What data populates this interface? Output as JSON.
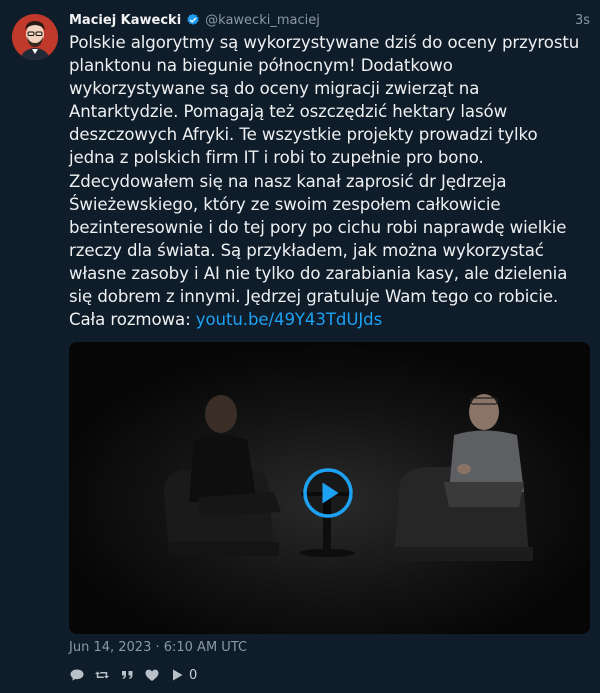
{
  "author": {
    "display_name": "Maciej Kawecki",
    "username": "@kawecki_maciej",
    "verified": true
  },
  "tweet": {
    "time_ago": "3s",
    "text_lines": [
      "Polskie algorytmy są wykorzystywane dziś do oceny przyrostu",
      "planktonu na biegunie północnym! Dodatkowo",
      "wykorzystywane są do oceny migracji zwierząt na",
      "Antarktydzie. Pomagają też oszczędzić hektary lasów",
      "deszczowych Afryki. Te wszystkie projekty prowadzi tylko",
      "jedna z polskich firm IT i robi to zupełnie pro bono.",
      "Zdecydowałem się na nasz kanał zaprosić dr Jędrzeja",
      "Świeżewskiego, który ze swoim zespołem całkowicie",
      "bezinteresownie i do tej pory po cichu robi naprawdę wielkie",
      "rzeczy dla świata. Są przykładem, jak można wykorzystać",
      "własne zasoby i AI nie tylko do zarabiania kasy, ale dzielenia",
      "się dobrem z innymi. Jędrzej gratuluje Wam tego co robicie."
    ],
    "link_prefix": "Cała rozmowa: ",
    "link_text": "youtu.be/49Y43TdUJds",
    "date": "Jun 14, 2023 · 6:10 AM UTC"
  },
  "actions": {
    "reply_icon": "comment-icon",
    "retweet_icon": "retweet-icon",
    "quote_icon": "quote-icon",
    "like_icon": "heart-icon",
    "play_icon": "play-icon",
    "play_count": "0"
  },
  "colors": {
    "background": "#0f1c29",
    "link": "#1da1f2",
    "verified": "#1d9bf0",
    "muted": "#8b98a5"
  }
}
